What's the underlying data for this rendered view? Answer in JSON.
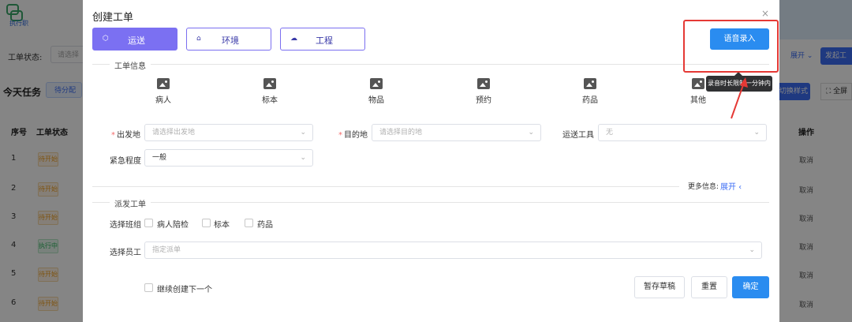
{
  "background": {
    "logo_text": "执行职",
    "filter_label": "工单状态:",
    "filter_placeholder": "请选择",
    "today_title": "今天任务",
    "pending_tab": "待分配",
    "expand_link": "展开",
    "create_button": "发起工单",
    "switch_button": "切换样式",
    "fullscreen_button": "全屏",
    "table_headers": [
      "序号",
      "工单状态",
      "操作"
    ],
    "rows": [
      {
        "index": "1",
        "status": "待开始",
        "action": "取消"
      },
      {
        "index": "2",
        "status": "待开始",
        "action": "取消"
      },
      {
        "index": "3",
        "status": "待开始",
        "action": "取消"
      },
      {
        "index": "4",
        "status": "执行中",
        "action": "取消"
      },
      {
        "index": "5",
        "status": "待开始",
        "action": "取消"
      },
      {
        "index": "6",
        "status": "待开始",
        "action": "取消"
      }
    ]
  },
  "modal": {
    "title": "创建工单",
    "close_icon": "×",
    "tabs": [
      {
        "label": "运送",
        "icon": "box-icon",
        "glyph": "⬡",
        "active": true
      },
      {
        "label": "环境",
        "icon": "building-icon",
        "glyph": "⌂",
        "active": false
      },
      {
        "label": "工程",
        "icon": "cloud-icon",
        "glyph": "☁",
        "active": false
      }
    ],
    "voice_button": "语音录入",
    "voice_tooltip": "录音时长限制一分钟内",
    "section_info": "工单信息",
    "categories": [
      "病人",
      "标本",
      "物品",
      "预约",
      "药品",
      "其他"
    ],
    "fields": {
      "origin": {
        "label": "出发地",
        "placeholder": "请选择出发地"
      },
      "destination": {
        "label": "目的地",
        "placeholder": "请选择目的地"
      },
      "tool": {
        "label": "运送工具",
        "value": "无"
      },
      "urgency": {
        "label": "紧急程度",
        "value": "一般"
      }
    },
    "more_info_label": "更多信息:",
    "more_info_expand": "展开",
    "section_dispatch": "派发工单",
    "team_label": "选择班组",
    "teams": [
      "病人陪检",
      "标本",
      "药品"
    ],
    "staff_label": "选择员工",
    "staff_placeholder": "指定派单",
    "continue_label": "继续创建下一个",
    "buttons": {
      "draft": "暂存草稿",
      "reset": "重置",
      "confirm": "确定"
    }
  },
  "colors": {
    "accent": "#7b70f2",
    "primary": "#2a8cf0",
    "annotation_red": "#e53935"
  }
}
